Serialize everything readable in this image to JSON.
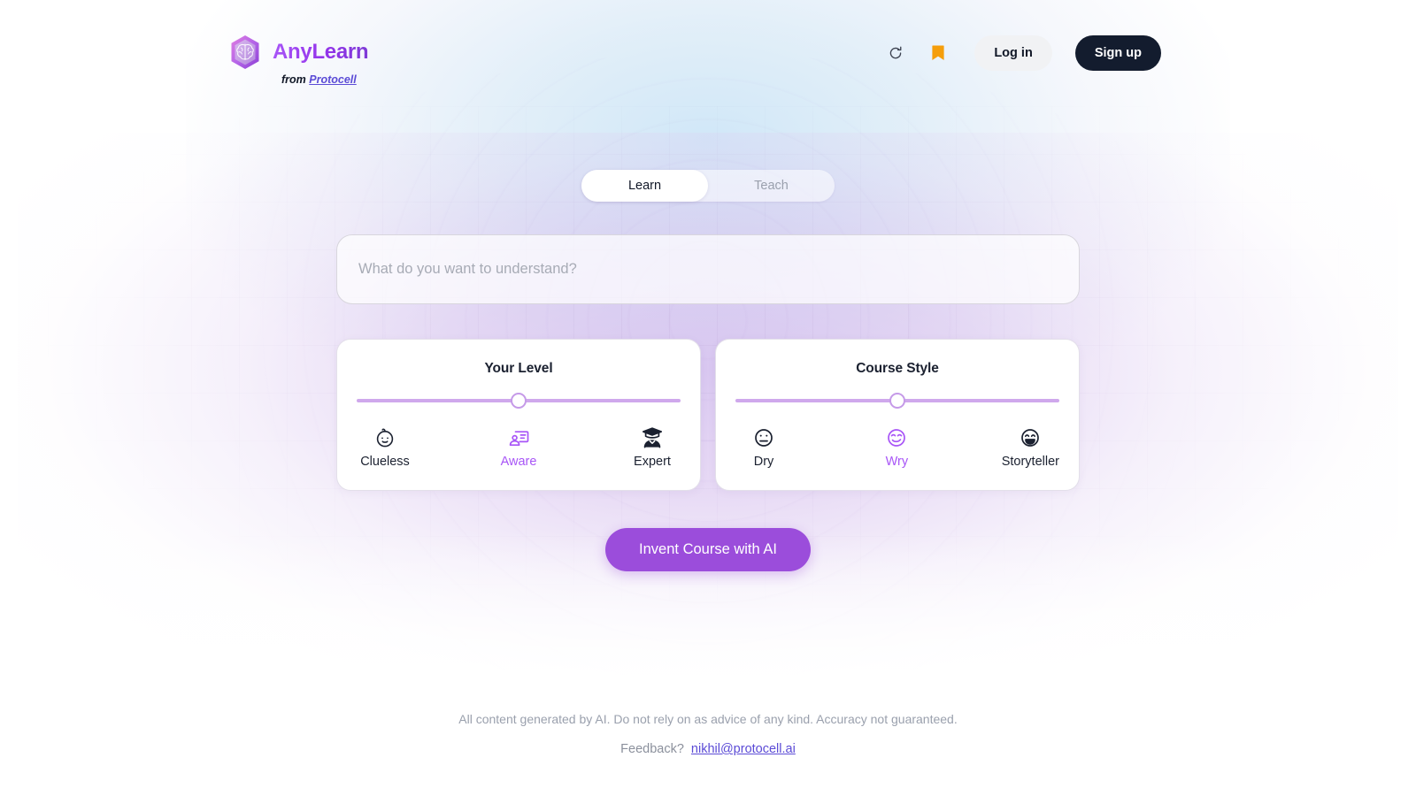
{
  "brand": {
    "name": "AnyLearn",
    "from_prefix": "from ",
    "parent": "Protocell",
    "logo_icon": "brain-hexagon-logo"
  },
  "header": {
    "history_icon": "refresh-history-icon",
    "bookmark_icon": "bookmark-icon",
    "bookmark_color": "#f59e0b",
    "login_label": "Log in",
    "signup_label": "Sign up"
  },
  "mode_toggle": {
    "tabs": [
      {
        "label": "Learn",
        "active": true
      },
      {
        "label": "Teach",
        "active": false
      }
    ]
  },
  "prompt": {
    "value": "",
    "placeholder": "What do you want to understand?"
  },
  "level_card": {
    "title": "Your Level",
    "slider_value": 50,
    "options": [
      {
        "label": "Clueless",
        "icon": "baby-face-icon",
        "selected": false
      },
      {
        "label": "Aware",
        "icon": "person-id-card-icon",
        "selected": true
      },
      {
        "label": "Expert",
        "icon": "graduation-person-icon",
        "selected": false
      }
    ]
  },
  "style_card": {
    "title": "Course Style",
    "slider_value": 50,
    "options": [
      {
        "label": "Dry",
        "icon": "neutral-face-icon",
        "selected": false
      },
      {
        "label": "Wry",
        "icon": "smirking-face-icon",
        "selected": true
      },
      {
        "label": "Storyteller",
        "icon": "laughing-face-icon",
        "selected": false
      }
    ]
  },
  "cta": {
    "label": "Invent Course with AI",
    "color": "#9b4ddb"
  },
  "footer": {
    "disclaimer": "All content generated by AI. Do not rely on as advice of any kind. Accuracy not guaranteed.",
    "feedback_label": "Feedback?",
    "feedback_email": "nikhil@protocell.ai"
  },
  "theme": {
    "accent": "#a855f7",
    "slider_track": "#cfa8ec",
    "dark": "#131c2e"
  }
}
